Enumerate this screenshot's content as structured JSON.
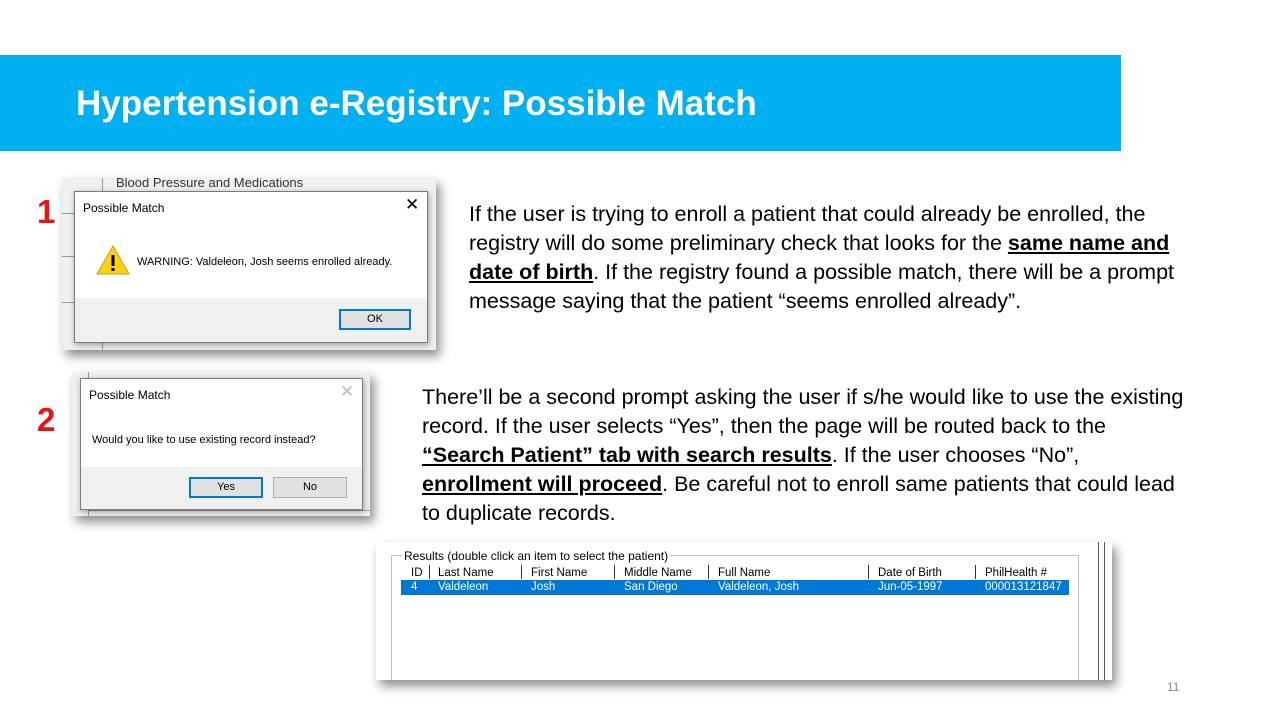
{
  "slide": {
    "title": "Hypertension e-Registry: Possible Match",
    "page_number": "11"
  },
  "step1": {
    "number": "1",
    "background_text": "Blood Pressure and Medications",
    "dialog": {
      "title": "Possible Match",
      "close_glyph": "✕",
      "icon": "warning-icon",
      "message": "WARNING: Valdeleon, Josh seems enrolled already.",
      "ok_label": "OK"
    },
    "paragraph": {
      "t1": "If the user is trying to enroll a patient that could already be enrolled, the registry will do some preliminary check that looks for the ",
      "b1": "same name and date of birth",
      "t2": ". If the registry found a possible match, there will be a prompt message saying that the patient “seems enrolled already”."
    }
  },
  "step2": {
    "number": "2",
    "dialog": {
      "title": "Possible Match",
      "close_glyph": "✕",
      "message": "Would you like to use existing record instead?",
      "yes_label": "Yes",
      "no_label": "No"
    },
    "paragraph": {
      "t1": "There’ll be a second prompt asking the user if s/he would like to use the existing record. If the user selects “Yes”, then the page will be routed back to the ",
      "b1": "“Search Patient” tab with search results",
      "t2": ". If the user chooses “No”, ",
      "b2": "enrollment will proceed",
      "t3": ". Be careful not to enroll same patients that could lead to duplicate records."
    }
  },
  "results": {
    "group_label": "Results (double click an item to select the patient)",
    "columns": [
      "ID",
      "Last Name",
      "First Name",
      "Middle Name",
      "Full Name",
      "Date of Birth",
      "PhilHealth #"
    ],
    "row": [
      "4",
      "Valdeleon",
      "Josh",
      "San Diego",
      "Valdeleon, Josh",
      "Jun-05-1997",
      "000013121847"
    ]
  },
  "colors": {
    "title_bar": "#00b0f0",
    "step_number": "#ee1111",
    "selection": "#0078d7"
  }
}
